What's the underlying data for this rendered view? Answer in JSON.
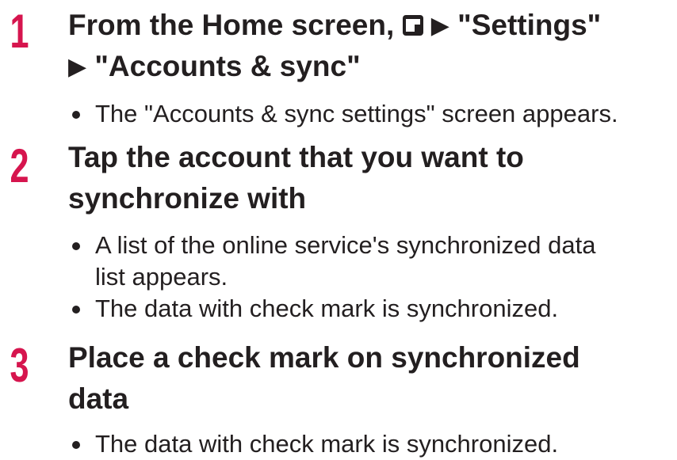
{
  "steps": [
    {
      "number": "1",
      "heading_line1_text": "From the Home screen,",
      "menu_icon": "menu-key-icon",
      "arrow": "▶",
      "heading_line1_target": "\"Settings\"",
      "heading_line2_target": "\"Accounts & sync\"",
      "bullets": [
        "The \"Accounts & sync settings\" screen appears."
      ]
    },
    {
      "number": "2",
      "heading_line1": "Tap the account that you want to",
      "heading_line2": "synchronize with",
      "bullets": [
        "A list of the online service's synchronized data",
        "list appears.",
        "The data with check mark is synchronized."
      ]
    },
    {
      "number": "3",
      "heading_line1": "Place a check mark on synchronized",
      "heading_line2": "data",
      "bullets": [
        "The data with check mark is synchronized."
      ]
    }
  ],
  "colors": {
    "step_number": "#d6154e",
    "text": "#231f20"
  }
}
